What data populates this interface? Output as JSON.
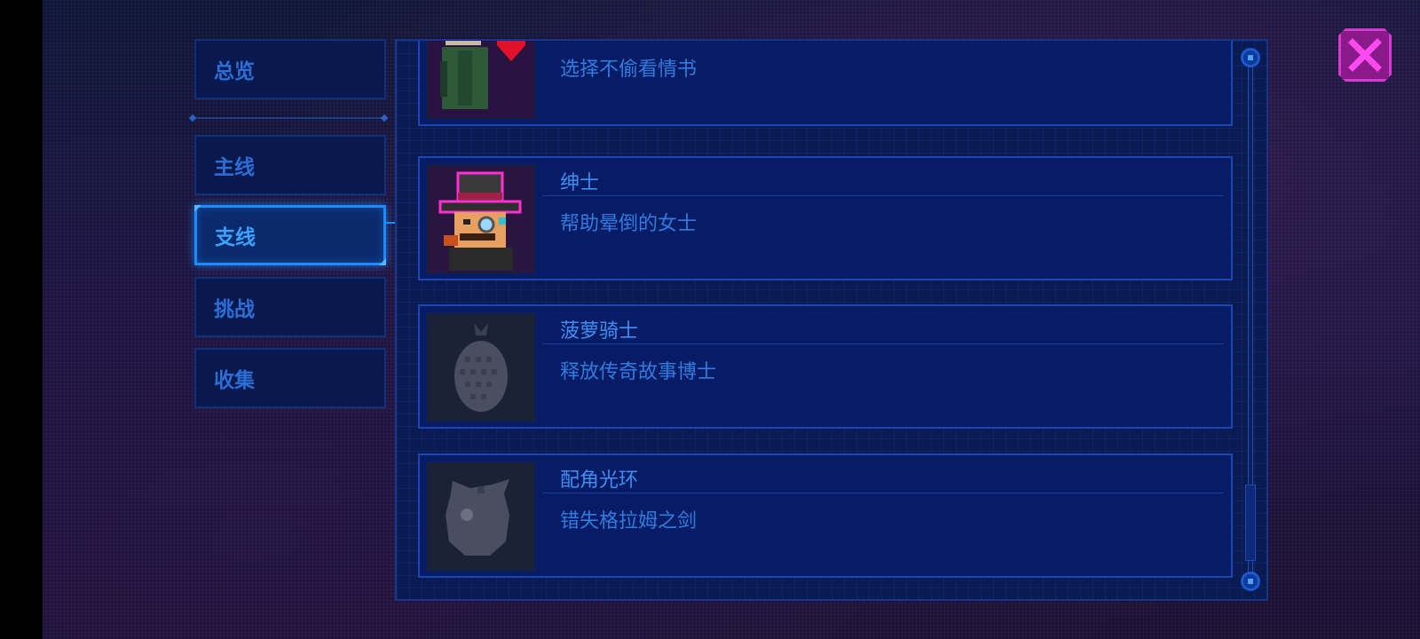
{
  "sidebar": {
    "tabs": [
      {
        "label": "总览",
        "active": false
      },
      {
        "label": "主线",
        "active": false
      },
      {
        "label": "支线",
        "active": true
      },
      {
        "label": "挑战",
        "active": false
      },
      {
        "label": "收集",
        "active": false
      }
    ]
  },
  "achievements": [
    {
      "title": "",
      "description": "选择不偷看情书",
      "unlocked": true,
      "icon": "old-man-with-heart-icon"
    },
    {
      "title": "绅士",
      "description": "帮助晕倒的女士",
      "unlocked": true,
      "icon": "gentleman-top-hat-icon"
    },
    {
      "title": "菠萝骑士",
      "description": "释放传奇故事博士",
      "unlocked": false,
      "icon": "pineapple-silhouette-icon"
    },
    {
      "title": "配角光环",
      "description": "错失格拉姆之剑",
      "unlocked": false,
      "icon": "round-bag-silhouette-icon"
    }
  ],
  "colors": {
    "panel_bg": "#0a1a52",
    "card_bg": "#071c64",
    "accent_blue": "#1b8cff",
    "close_accent": "#d33ad0"
  },
  "close_button": {
    "icon": "close-x-icon"
  }
}
